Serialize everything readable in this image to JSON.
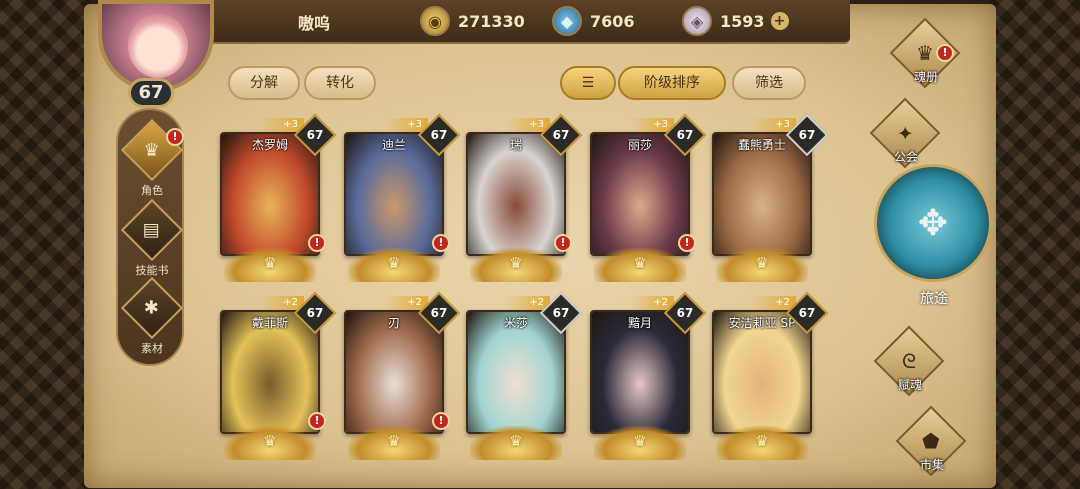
{
  "player": {
    "name": "嗷呜",
    "level": "67"
  },
  "resources": [
    {
      "icon": "gold-coin-icon",
      "value": "271330"
    },
    {
      "icon": "blue-crystal-icon",
      "value": "7606"
    },
    {
      "icon": "white-crystal-icon",
      "value": "1593"
    }
  ],
  "left_nav": [
    {
      "label": "角色",
      "icon": "character-icon",
      "alert": "!"
    },
    {
      "label": "技能书",
      "icon": "skill-book-icon"
    },
    {
      "label": "素材",
      "icon": "material-icon"
    }
  ],
  "actions": {
    "decompose": "分解",
    "convert": "转化",
    "sort_by_tier": "阶级排序",
    "filter": "筛选"
  },
  "heroes": [
    {
      "name": "杰罗姆",
      "plus": "+3",
      "level": "67",
      "alert": "!",
      "colors": [
        "#c24a2c",
        "#e7b55a"
      ]
    },
    {
      "name": "迪兰",
      "plus": "+3",
      "level": "67",
      "alert": "!",
      "colors": [
        "#5a6a9a",
        "#c99a6a"
      ]
    },
    {
      "name": "瑞",
      "plus": "+3",
      "level": "67",
      "alert": "!",
      "colors": [
        "#d8d4d0",
        "#8a4a3a"
      ]
    },
    {
      "name": "丽莎",
      "plus": "+3",
      "level": "67",
      "alert": "!",
      "colors": [
        "#6a3a4a",
        "#e0a88a"
      ]
    },
    {
      "name": "蠢熊勇士",
      "plus": "+3",
      "level": "67",
      "alert": "",
      "colors": [
        "#9c6a44",
        "#d8b28a"
      ]
    },
    {
      "name": "戴菲斯",
      "plus": "+2",
      "level": "67",
      "alert": "!",
      "colors": [
        "#e4c25a",
        "#7a5a2a"
      ]
    },
    {
      "name": "刃",
      "plus": "+2",
      "level": "67",
      "alert": "!",
      "colors": [
        "#a06a4a",
        "#e8e0d8"
      ]
    },
    {
      "name": "米莎",
      "plus": "+2",
      "level": "67",
      "alert": "",
      "colors": [
        "#a0d4d0",
        "#f2e0d2"
      ]
    },
    {
      "name": "黯月",
      "plus": "+2",
      "level": "67",
      "alert": "",
      "colors": [
        "#2a2a38",
        "#e8c8c8"
      ]
    },
    {
      "name": "安洁莉亚 SP",
      "plus": "+2",
      "level": "67",
      "alert": "",
      "colors": [
        "#f0d690",
        "#e6b27a"
      ]
    }
  ],
  "right_nav": [
    {
      "label": "魂册",
      "icon": "soul-book-icon",
      "alert": "!"
    },
    {
      "label": "公会",
      "icon": "guild-icon"
    },
    {
      "label": "旅途",
      "icon": "journey-icon"
    },
    {
      "label": "赋魂",
      "icon": "infuse-soul-icon"
    },
    {
      "label": "市集",
      "icon": "market-icon"
    }
  ],
  "alert_mark": "!",
  "plus_symbol": "+"
}
